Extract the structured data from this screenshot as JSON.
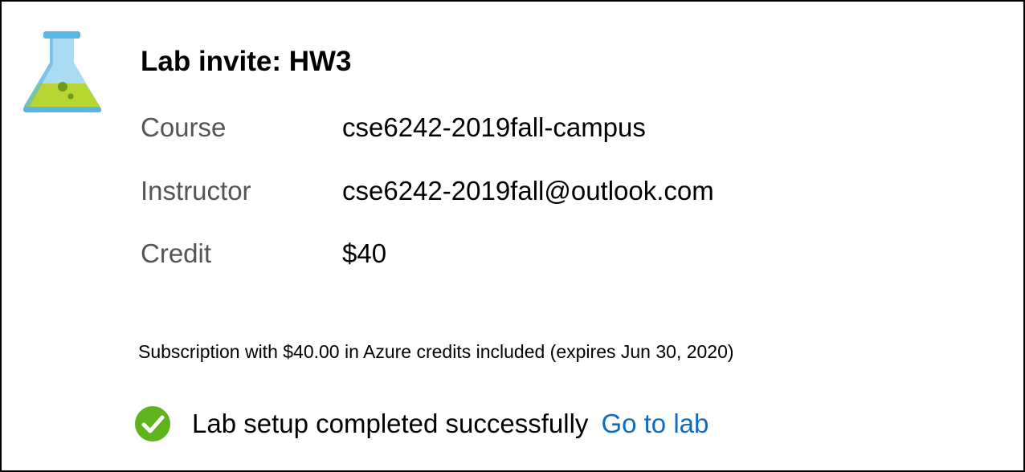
{
  "invite": {
    "title": "Lab invite: HW3",
    "icon": "lab-flask-icon"
  },
  "details": [
    {
      "label": "Course",
      "value": "cse6242-2019fall-campus"
    },
    {
      "label": "Instructor",
      "value": "cse6242-2019fall@outlook.com"
    },
    {
      "label": "Credit",
      "value": "$40"
    }
  ],
  "subscription_note": "Subscription with $40.00 in Azure credits included (expires Jun 30, 2020)",
  "status": {
    "icon": "checkmark-circle-icon",
    "message": "Lab setup completed successfully",
    "link_label": "Go to lab"
  },
  "colors": {
    "success": "#5fb31d",
    "link": "#0f6cbd",
    "flask_blue": "#57b7e4",
    "flask_liquid": "#b7d631"
  }
}
